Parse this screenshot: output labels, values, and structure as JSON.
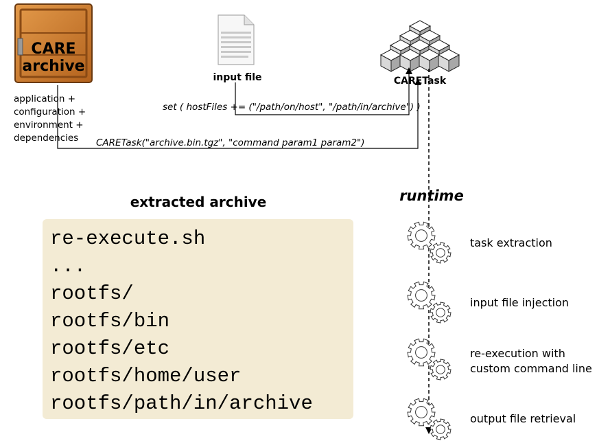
{
  "crate": {
    "line1": "CARE",
    "line2": "archive",
    "contents": [
      "application +",
      "configuration +",
      "environment +",
      "dependencies"
    ]
  },
  "input_file": {
    "label": "input file"
  },
  "caretask": {
    "label": "CARETask"
  },
  "arrows": {
    "set_label": "set ( hostFiles += (\"/path/on/host\", \"/path/in/archive\") )",
    "task_label": "CARETask(\"archive.bin.tgz\", \"command param1 param2\")"
  },
  "extracted": {
    "title": "extracted archive",
    "lines": [
      "re-execute.sh",
      "...",
      "rootfs/",
      "rootfs/bin",
      "rootfs/etc",
      "rootfs/home/user",
      "rootfs/path/in/archive"
    ]
  },
  "runtime": {
    "title": "runtime",
    "steps": [
      "task extraction",
      "input file injection",
      "re-execution with custom command line",
      "output file retrieval"
    ]
  }
}
